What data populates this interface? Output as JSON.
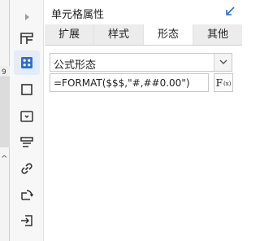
{
  "canvas": {
    "row_number": "9"
  },
  "toolbar": {
    "items": [
      {
        "icon": "expand-arrow-icon"
      },
      {
        "icon": "cell-layout-icon"
      },
      {
        "icon": "cell-attribute-icon",
        "active": true
      },
      {
        "icon": "border-square-icon"
      },
      {
        "icon": "widget-icon"
      },
      {
        "icon": "list-icon"
      },
      {
        "icon": "hyperlink-icon"
      },
      {
        "icon": "chart-refresh-icon"
      },
      {
        "icon": "import-icon"
      }
    ],
    "accent_color": "#2a6fd0"
  },
  "panel": {
    "title": "单元格属性",
    "tabs": [
      {
        "label": "扩展"
      },
      {
        "label": "样式"
      },
      {
        "label": "形态",
        "active": true
      },
      {
        "label": "其他"
      }
    ],
    "form_select": {
      "value": "公式形态"
    },
    "formula": {
      "value": "=FORMAT($$$,\"#,##0.00\")"
    },
    "fx_button": {
      "label": "F",
      "sub": "(x)"
    }
  }
}
